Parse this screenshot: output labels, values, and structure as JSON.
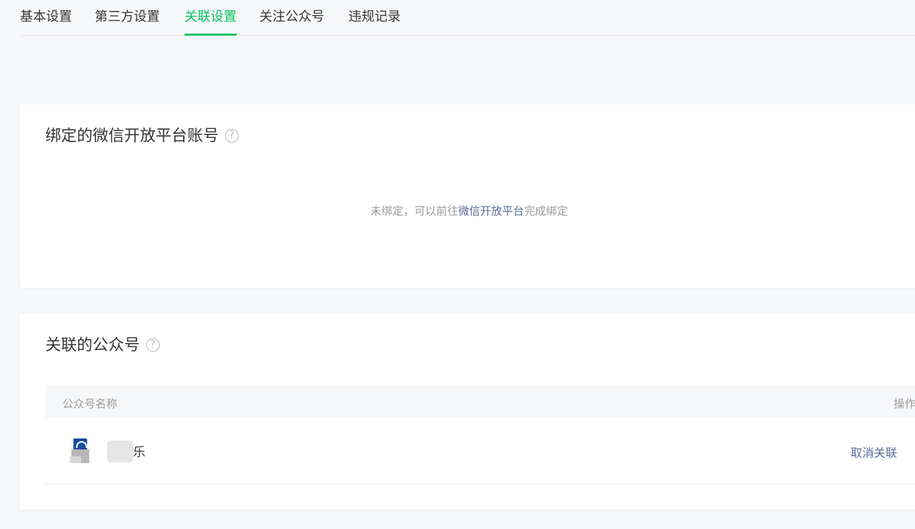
{
  "tabs": [
    {
      "label": "基本设置"
    },
    {
      "label": "第三方设置"
    },
    {
      "label": "关联设置"
    },
    {
      "label": "关注公众号"
    },
    {
      "label": "违规记录"
    }
  ],
  "active_tab": "关联设置",
  "accent_color": "#07c160",
  "link_color": "#576b95",
  "open_platform": {
    "title": "绑定的微信开放平台账号",
    "help_icon": "question-circle-icon",
    "empty_prefix": "未绑定，可以前往",
    "empty_link": "微信开放平台",
    "empty_suffix": "完成绑定"
  },
  "linked_accounts": {
    "title": "关联的公众号",
    "help_icon": "question-circle-icon",
    "columns": {
      "name": "公众号名称",
      "operation": "操作"
    },
    "rows": [
      {
        "avatar_icon": "account-avatar",
        "name": "乐",
        "action": "取消关联"
      }
    ]
  }
}
